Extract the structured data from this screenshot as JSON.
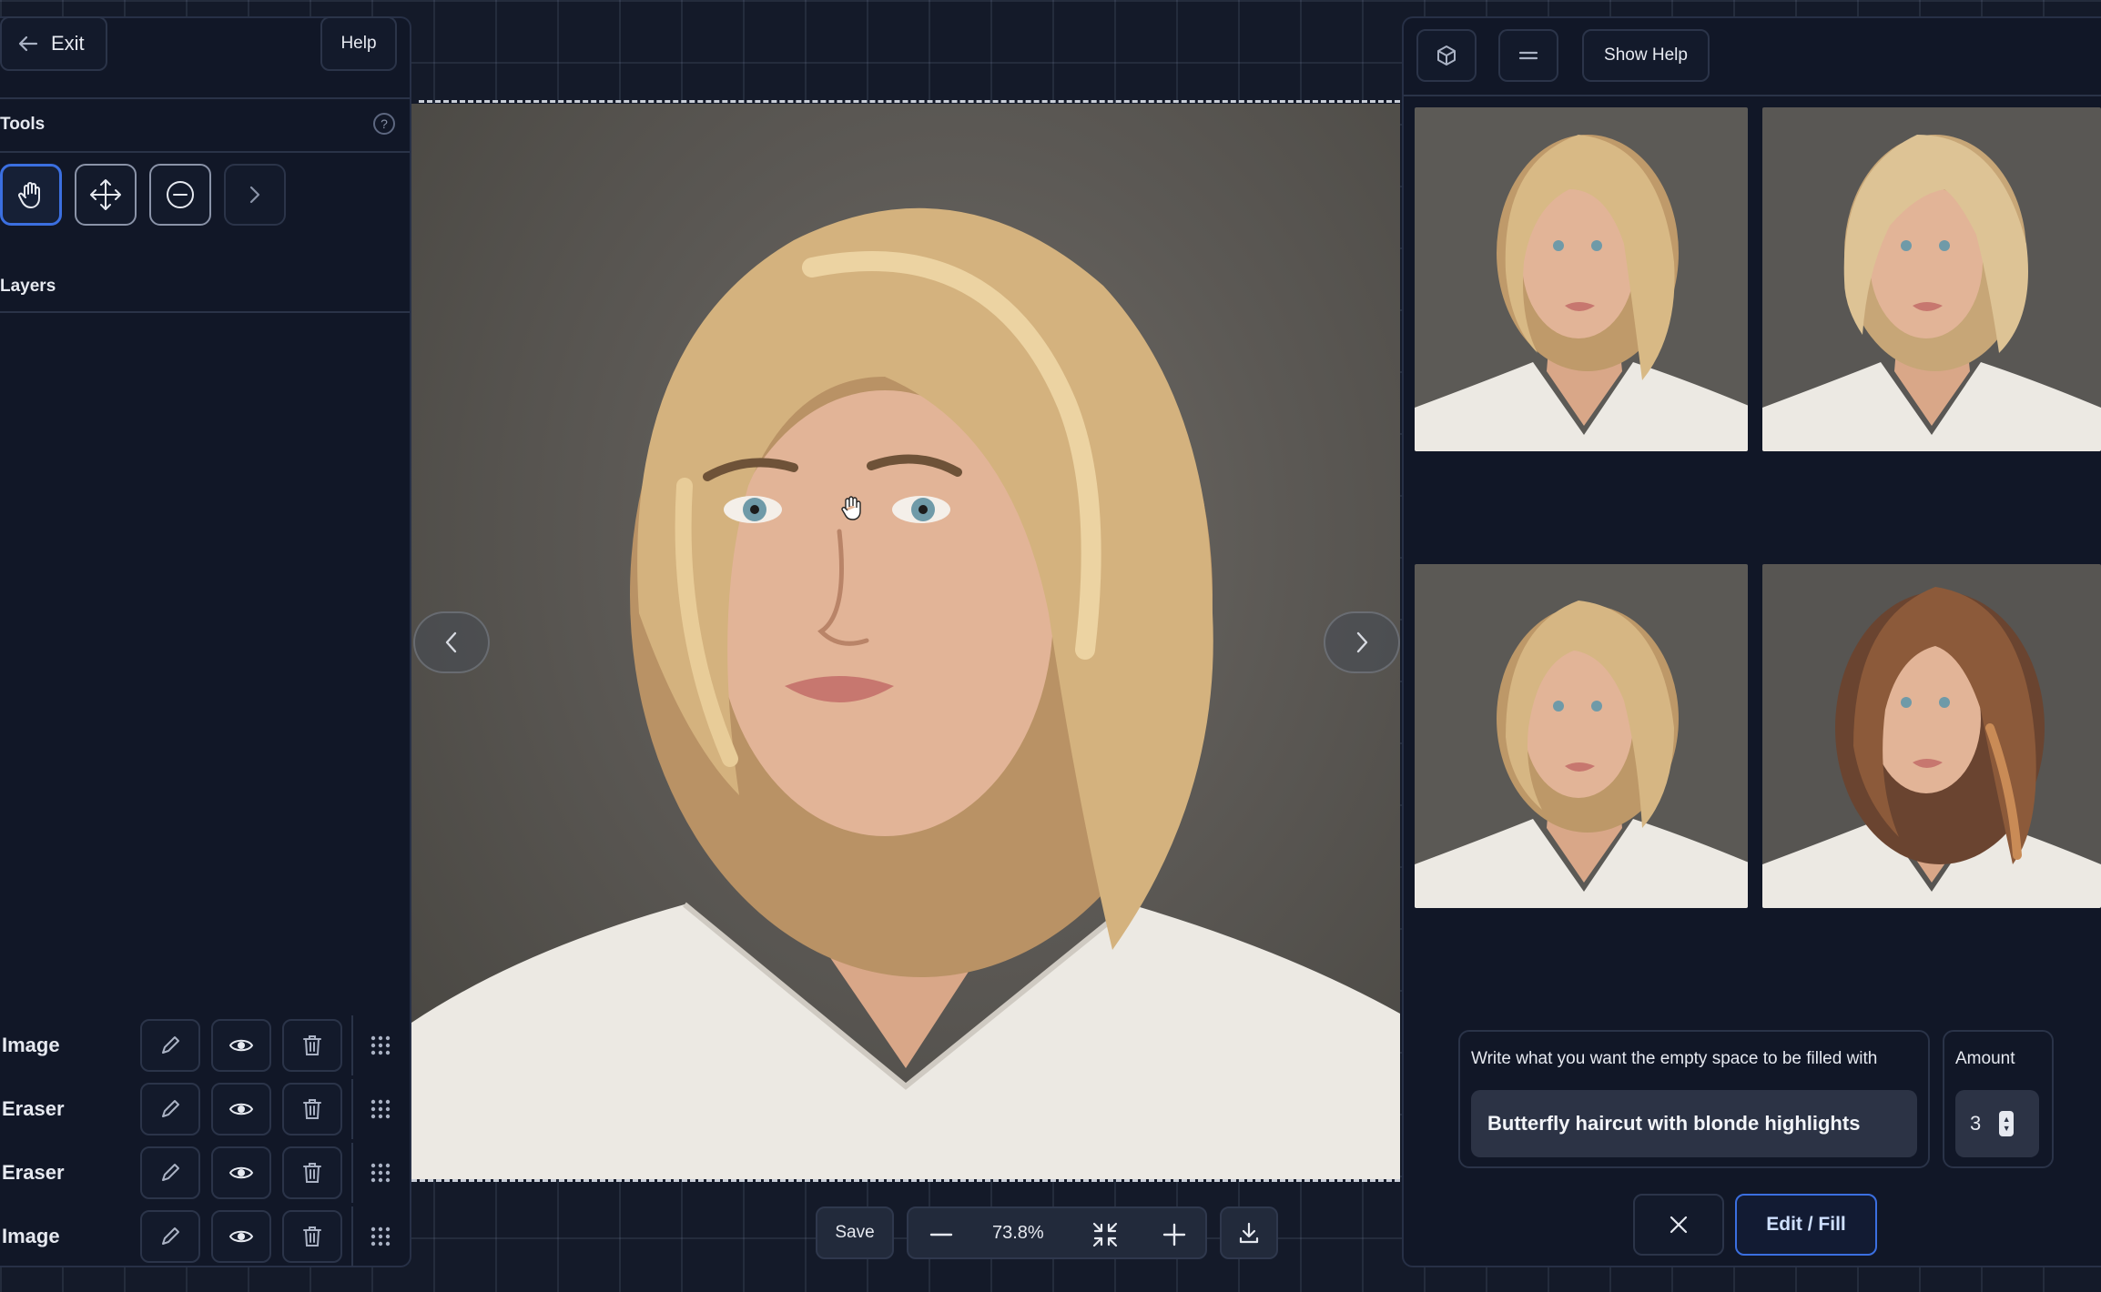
{
  "header": {
    "exit_label": "Exit",
    "help_label": "Help",
    "show_help_label": "Show Help"
  },
  "tools": {
    "title": "Tools",
    "help_icon": "?",
    "items": [
      {
        "name": "hand-icon",
        "active": true
      },
      {
        "name": "move-icon",
        "active": false
      },
      {
        "name": "eraser-icon",
        "active": false
      },
      {
        "name": "chevron-right-icon",
        "active": false
      }
    ]
  },
  "layers": {
    "title": "Layers",
    "items": [
      {
        "label": "Image"
      },
      {
        "label": "Eraser"
      },
      {
        "label": "Eraser"
      },
      {
        "label": "Image"
      }
    ]
  },
  "toolbar": {
    "save_label": "Save",
    "zoom_value": "73.8%"
  },
  "generate": {
    "prompt_label": "Write what you want the empty space to be filled with",
    "prompt_value": "Butterfly haircut with blonde highlights",
    "amount_label": "Amount",
    "amount_value": "3",
    "submit_label": "Edit / Fill"
  },
  "results": [
    {
      "hair": "blonde wavy bob, right side-swept"
    },
    {
      "hair": "blonde wavy bob, left side-swept"
    },
    {
      "hair": "blonde curled bob"
    },
    {
      "hair": "brunette layered with highlights"
    }
  ],
  "colors": {
    "accent": "#3b6fe0",
    "background": "#141a29",
    "panel": "#111727",
    "border": "#273046"
  }
}
